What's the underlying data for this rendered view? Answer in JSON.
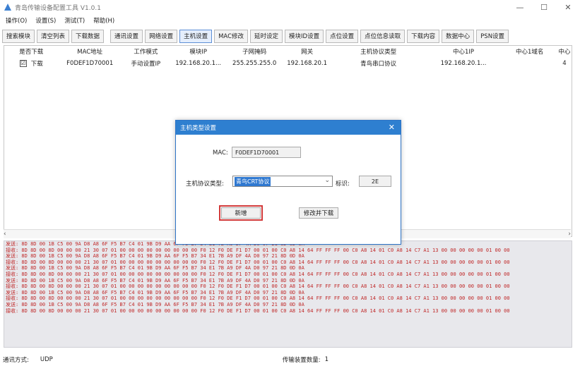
{
  "window": {
    "title": "青岛传输设备配置工具 V1.0.1",
    "controls": [
      "—",
      "☐",
      "✕"
    ]
  },
  "menu": [
    "操作(O)",
    "设置(S)",
    "测试(T)",
    "帮助(H)"
  ],
  "toolbar": [
    "搜索模块",
    "清空列表",
    "下载数据",
    "通讯设置",
    "网络设置",
    "主机设置",
    "MAC修改",
    "延时设定",
    "模块ID设置",
    "点位设置",
    "点位信息读取",
    "下载内容",
    "数据中心",
    "PSN设置"
  ],
  "toolbar_active": "主机设置",
  "table": {
    "headers": [
      "是否下载",
      "MAC地址",
      "工作模式",
      "模块IP",
      "子网掩码",
      "网关",
      "主机协议类型",
      "中心1IP",
      "中心1域名",
      "中心"
    ],
    "rows": [
      {
        "checked": "☑",
        "cells": [
          "下载",
          "F0DEF1D70001",
          "手动设置IP",
          "192.168.20.1...",
          "255.255.255.0",
          "192.168.20.1",
          "青鸟串口协议",
          "192.168.20.1...",
          "",
          "4"
        ]
      }
    ]
  },
  "log": [
    "发送: 8D 8D 00 1B C5 00 9A D8 A8 6F F5 B7 C4 01 9B D9 AA 6F F5 B7 34 E1 7B A9 DF 4A D0 97 21 8D 0D 0A",
    "接收: 8D 8D 00 8D 00 00 00 21 30 07 01 00 00 00 00 00 00 00 00 00 F0 12 F0 DE F1 D7 00 01 00 C0 A8 14 64 FF FF FF 00 C0 A8 14 01 C0 A8 14 C7 A1 13 00 00 00 00 00 01 00 00",
    "发送: 8D 8D 00 1B C5 00 9A D8 A8 6F F5 B7 C4 01 9B D9 AA 6F F5 B7 34 E1 7B A9 DF 4A D0 97 21 8D 0D 0A",
    "接收: 8D 8D 00 8D 00 00 00 21 30 07 01 00 00 00 00 00 00 00 00 00 F0 12 F0 DE F1 D7 00 01 00 C0 A8 14 64 FF FF FF 00 C0 A8 14 01 C0 A8 14 C7 A1 13 00 00 00 00 00 01 00 00",
    "发送: 8D 8D 00 1B C5 00 9A D8 A8 6F F5 B7 C4 01 9B D9 AA 6F F5 B7 34 E1 7B A9 DF 4A D0 97 21 8D 0D 0A",
    "接收: 8D 8D 00 8D 00 00 00 21 30 07 01 00 00 00 00 00 00 00 00 00 F0 12 F0 DE F1 D7 00 01 00 C0 A8 14 64 FF FF FF 00 C0 A8 14 01 C0 A8 14 C7 A1 13 00 00 00 00 00 01 00 00",
    "发送: 8D 8D 00 1B C5 00 9A D8 A8 6F F5 B7 C4 01 9B D9 AA 6F F5 B7 34 E1 7B A9 DF 4A D0 97 21 8D 0D 0A",
    "接收: 8D 8D 00 8D 00 00 00 21 30 07 01 00 00 00 00 00 00 00 00 00 F0 12 F0 DE F1 D7 00 01 00 C0 A8 14 64 FF FF FF 00 C0 A8 14 01 C0 A8 14 C7 A1 13 00 00 00 00 00 01 00 00",
    "发送: 8D 8D 00 1B C5 00 9A D8 A8 6F F5 B7 C4 01 9B D9 AA 6F F5 B7 34 E1 7B A9 DF 4A D0 97 21 8D 0D 0A",
    "接收: 8D 8D 00 8D 00 00 00 21 30 07 01 00 00 00 00 00 00 00 00 00 F0 12 F0 DE F1 D7 00 01 00 C0 A8 14 64 FF FF FF 00 C0 A8 14 01 C0 A8 14 C7 A1 13 00 00 00 00 00 01 00 00",
    "发送: 8D 8D 00 1B C5 00 9A D8 A8 6F F5 B7 C4 01 9B D9 AA 6F F5 B7 34 E1 7B A9 DF 4A D0 97 21 8D 0D 0A",
    "接收: 8D 8D 00 8D 00 00 00 21 30 07 01 00 00 00 00 00 00 00 00 00 F0 12 F0 DE F1 D7 00 01 00 C0 A8 14 64 FF FF FF 00 C0 A8 14 01 C0 A8 14 C7 A1 13 00 00 00 00 00 01 00 00"
  ],
  "status": {
    "comm_label": "通讯方式:",
    "comm_value": "UDP",
    "count_label": "传输装置数量:",
    "count_value": "1"
  },
  "dialog": {
    "title": "主机类型设置",
    "close": "✕",
    "mac_label": "MAC:",
    "mac_value": "F0DEF1D70001",
    "protocol_label": "主机协议类型:",
    "protocol_value": "青鸟CRT协议",
    "id_label": "标识:",
    "id_value": "2E",
    "add_button": "新增",
    "modify_button": "修改并下载"
  },
  "colors": {
    "dialog_titlebar": "#2e7fd0",
    "log_text": "#c02929",
    "highlight_outline": "#d23a3a"
  }
}
